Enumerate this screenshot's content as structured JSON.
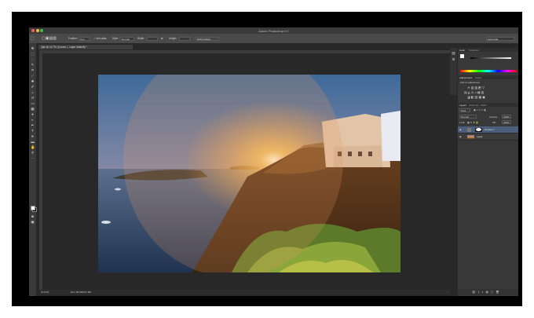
{
  "window": {
    "title": "Adobe Photoshop CC",
    "workspace": "Essentials"
  },
  "options_bar": {
    "feather_label": "Feather:",
    "feather_value": "0 px",
    "antialias_label": "Anti-alias",
    "style_label": "Style:",
    "style_value": "Normal",
    "width_label": "Width:",
    "height_label": "Height:",
    "refine_edge_label": "Refine Edge..."
  },
  "document": {
    "tab_label": "Zykl @ 16.7% (Curves 1, Layer Mask/8) *",
    "zoom": "16.67%",
    "doc_info": "Doc: 86.9M/117.8M"
  },
  "panels": {
    "color_tabs": [
      "Color",
      "Swatches"
    ],
    "adjust_tabs": [
      "Adjustments",
      "Styles"
    ],
    "adjust_heading": "Add an adjustment",
    "layers_tabs": [
      "Layers",
      "Channels",
      "Paths"
    ],
    "filter_kind": "Kind",
    "blend_mode": "Normal",
    "opacity_label": "Opacity:",
    "opacity_value": "100%",
    "lock_label": "Lock:",
    "fill_label": "Fill:",
    "fill_value": "100%",
    "layers": [
      {
        "name": "Curves 1",
        "selected": true
      },
      {
        "name": "Layer",
        "selected": false
      }
    ]
  },
  "colors": {
    "app_bg": "#282828",
    "selected_layer": "#4b5f7c",
    "foreground": "#ffffff",
    "background": "#000000"
  }
}
